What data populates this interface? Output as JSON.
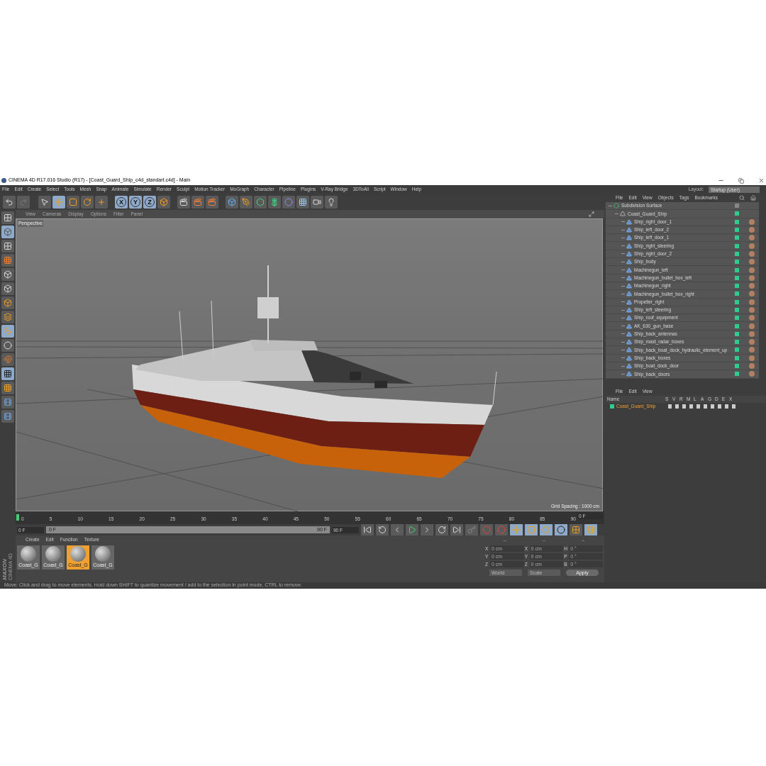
{
  "window": {
    "title": "CINEMA 4D R17.016 Studio (R17) - [Coast_Guard_Ship_c4d_standart.c4d] - Main"
  },
  "menu": [
    "File",
    "Edit",
    "Create",
    "Select",
    "Tools",
    "Mesh",
    "Snap",
    "Animate",
    "Simulate",
    "Render",
    "Sculpt",
    "Motion Tracker",
    "MoGraph",
    "Character",
    "Pipeline",
    "Plugins",
    "V-Ray Bridge",
    "3DToAll",
    "Script",
    "Window",
    "Help"
  ],
  "layout": {
    "label": "Layout:",
    "value": "Startup (User)"
  },
  "axis_buttons": [
    "X",
    "Y",
    "Z"
  ],
  "viewport": {
    "menu": [
      "View",
      "Cameras",
      "Display",
      "Options",
      "Filter",
      "Panel"
    ],
    "camera": "Perspective",
    "grid_spacing": "Grid Spacing : 1000 cm"
  },
  "object_manager": {
    "menu": [
      "File",
      "Edit",
      "View",
      "Objects",
      "Tags",
      "Bookmarks"
    ],
    "objects": [
      {
        "name": "Subdivision Surface",
        "kind": "subdivision",
        "children": [
          {
            "name": "Coast_Guard_Ship",
            "kind": "null",
            "children": [
              {
                "name": "Ship_right_door_1",
                "kind": "polygon"
              },
              {
                "name": "Ship_left_door_2",
                "kind": "polygon"
              },
              {
                "name": "Ship_left_door_1",
                "kind": "polygon"
              },
              {
                "name": "Ship_right_steering",
                "kind": "polygon"
              },
              {
                "name": "Ship_right_door_2",
                "kind": "polygon"
              },
              {
                "name": "Ship_body",
                "kind": "polygon"
              },
              {
                "name": "Machinegun_left",
                "kind": "polygon"
              },
              {
                "name": "Machinegun_bullet_box_left",
                "kind": "polygon"
              },
              {
                "name": "Machinegun_right",
                "kind": "polygon"
              },
              {
                "name": "Machinegun_bullet_box_right",
                "kind": "polygon"
              },
              {
                "name": "Propeller_right",
                "kind": "polygon"
              },
              {
                "name": "Ship_left_steering",
                "kind": "polygon"
              },
              {
                "name": "Ship_roof_equipment",
                "kind": "polygon"
              },
              {
                "name": "AK_630_gun_base",
                "kind": "polygon"
              },
              {
                "name": "Ship_back_antennas",
                "kind": "polygon"
              },
              {
                "name": "Ship_mast_radar_boxes",
                "kind": "polygon"
              },
              {
                "name": "Ship_back_boat_dock_hydraulic_element_up",
                "kind": "polygon"
              },
              {
                "name": "Ship_back_boxes",
                "kind": "polygon"
              },
              {
                "name": "Ship_boat_dock_door",
                "kind": "polygon"
              },
              {
                "name": "Ship_back_doors",
                "kind": "polygon"
              }
            ]
          }
        ]
      }
    ]
  },
  "layer_manager": {
    "menu": [
      "File",
      "Edit",
      "View"
    ],
    "name_header": "Name",
    "columns": [
      "S",
      "V",
      "R",
      "M",
      "L",
      "A",
      "G",
      "D",
      "E",
      "X"
    ],
    "layers": [
      {
        "name": "Coast_Guard_Ship",
        "color": "#2ecc8f"
      }
    ]
  },
  "timeline": {
    "ticks": [
      "0",
      "5",
      "10",
      "15",
      "20",
      "25",
      "30",
      "35",
      "40",
      "45",
      "50",
      "55",
      "60",
      "65",
      "70",
      "75",
      "80",
      "85",
      "90"
    ],
    "current_frame": "0 F",
    "start_frame": "0 F",
    "range_start": "0 F",
    "range_end": "90 F",
    "end_frame": "90 F",
    "level": 1
  },
  "material_manager": {
    "menu": [
      "Create",
      "Edit",
      "Function",
      "Texture"
    ],
    "materials": [
      {
        "name": "Coast_G",
        "selected": false
      },
      {
        "name": "Coast_G",
        "selected": false
      },
      {
        "name": "Coast_G",
        "selected": true
      },
      {
        "name": "Coast_G",
        "selected": false
      }
    ]
  },
  "brand": {
    "line1": "MAXON",
    "line2": "CINEMA 4D"
  },
  "coordinates": {
    "headers": [
      "--",
      "--",
      "--"
    ],
    "rows": [
      {
        "labels": [
          "X",
          "X",
          "H"
        ],
        "values": [
          "0 cm",
          "0 cm",
          "0 °"
        ]
      },
      {
        "labels": [
          "Y",
          "Y",
          "P"
        ],
        "values": [
          "0 cm",
          "0 cm",
          "0 °"
        ]
      },
      {
        "labels": [
          "Z",
          "Z",
          "B"
        ],
        "values": [
          "0 cm",
          "0 cm",
          "0 °"
        ]
      }
    ],
    "mode": "World",
    "size_mode": "Scale",
    "apply": "Apply"
  },
  "status_bar": "Move: Click and drag to move elements. Hold down SHIFT to quantize movement / add to the selection in point mode, CTRL to remove."
}
